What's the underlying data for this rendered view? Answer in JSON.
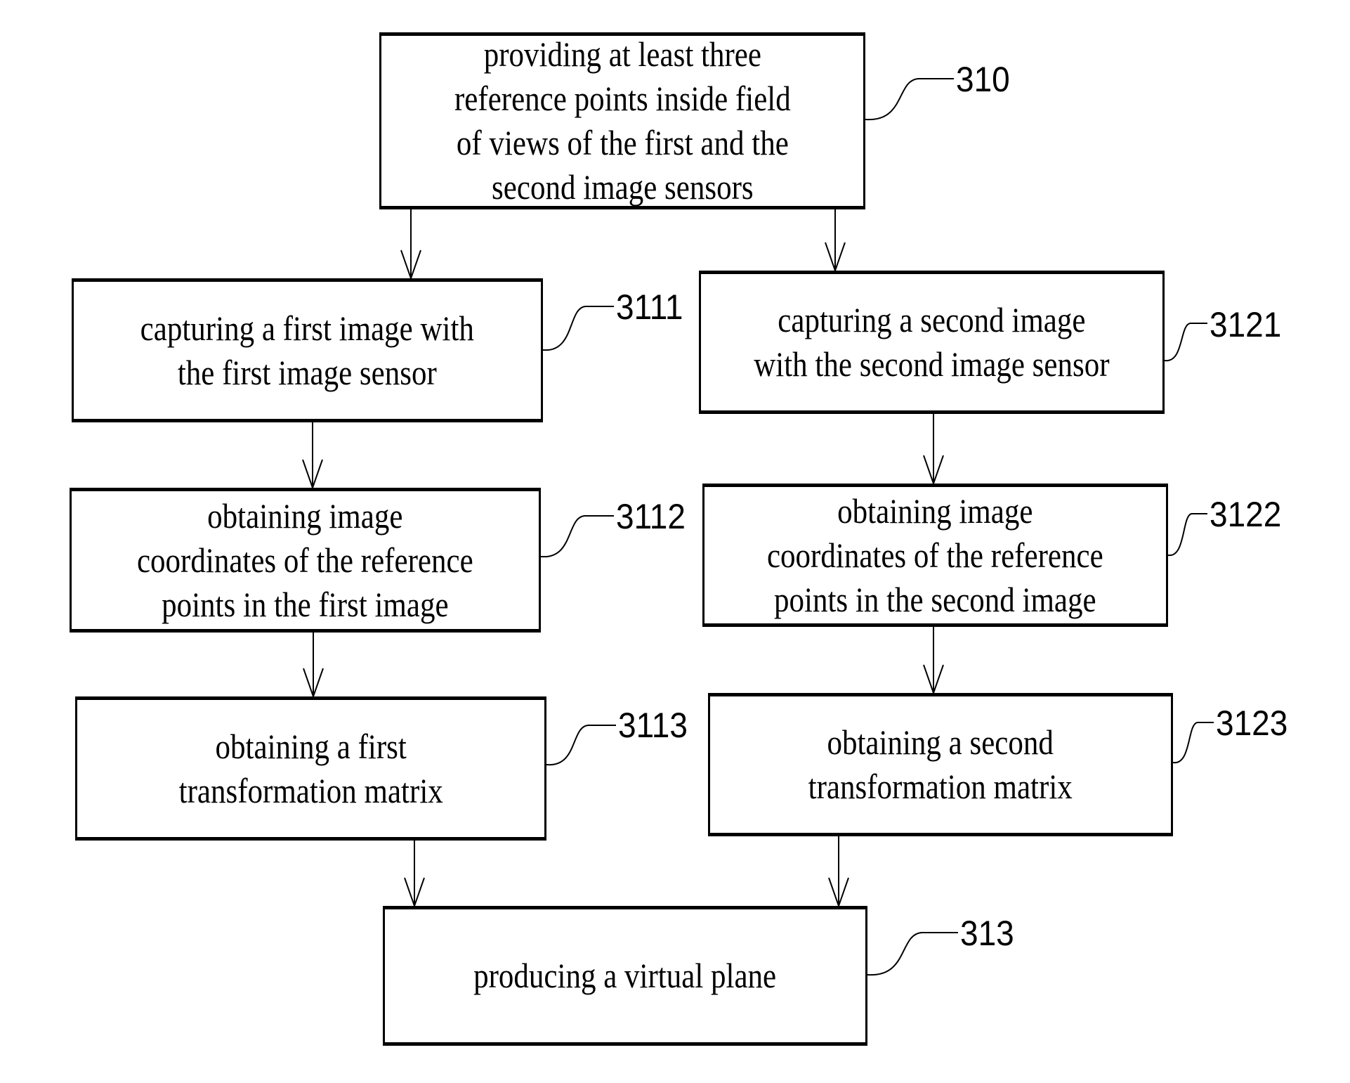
{
  "diagram": {
    "type": "flowchart",
    "steps": [
      {
        "id": "310",
        "label": "providing at least three\nreference points inside field\nof views of the first and the\nsecond image sensors"
      },
      {
        "id": "3111",
        "label": "capturing a first image with\nthe first image sensor"
      },
      {
        "id": "3121",
        "label": "capturing a second image\nwith the second image sensor"
      },
      {
        "id": "3112",
        "label": "obtaining image\ncoordinates of the reference\npoints in the first image"
      },
      {
        "id": "3122",
        "label": "obtaining image\ncoordinates of the reference\npoints in the second image"
      },
      {
        "id": "3113",
        "label": "obtaining a first\ntransformation matrix"
      },
      {
        "id": "3123",
        "label": "obtaining a second\ntransformation matrix"
      },
      {
        "id": "313",
        "label": "producing a virtual plane"
      }
    ],
    "edges": [
      {
        "from": "310",
        "to": "3111"
      },
      {
        "from": "310",
        "to": "3121"
      },
      {
        "from": "3111",
        "to": "3112"
      },
      {
        "from": "3121",
        "to": "3122"
      },
      {
        "from": "3112",
        "to": "3113"
      },
      {
        "from": "3122",
        "to": "3123"
      },
      {
        "from": "3113",
        "to": "313"
      },
      {
        "from": "3123",
        "to": "313"
      }
    ]
  }
}
